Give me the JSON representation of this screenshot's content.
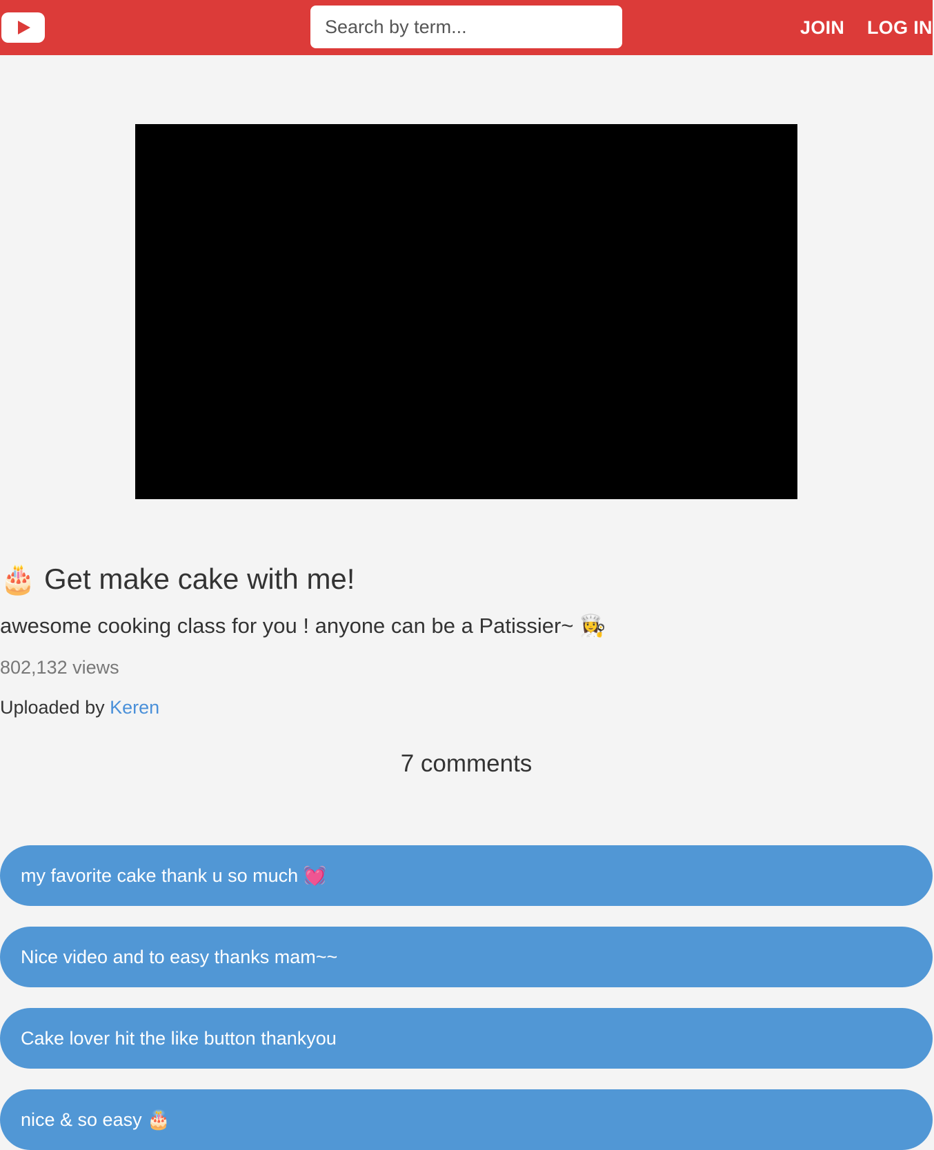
{
  "header": {
    "search": {
      "placeholder": "Search by term..."
    },
    "join_label": "JOIN",
    "login_label": "LOG IN"
  },
  "video": {
    "title": "🎂 Get make cake with me!",
    "description": "awesome cooking class for you ! anyone can be a Patissier~ 👩‍🍳",
    "views": "802,132 views",
    "uploaded_by_label": "Uploaded by",
    "uploader": "Keren"
  },
  "comments": {
    "heading": "7 comments",
    "items": [
      {
        "text": "my favorite cake thank u so much 💓"
      },
      {
        "text": "Nice video and to easy thanks mam~~"
      },
      {
        "text": "Cake lover hit the like button thankyou"
      },
      {
        "text": "nice & so easy 🎂"
      }
    ]
  },
  "colors": {
    "header_bg": "#dc3b39",
    "page_bg": "#f4f4f4",
    "comment_bg": "#5197d5",
    "link": "#4a90d9",
    "player_bg": "#000000"
  },
  "icons": {
    "logo": "play-icon"
  }
}
